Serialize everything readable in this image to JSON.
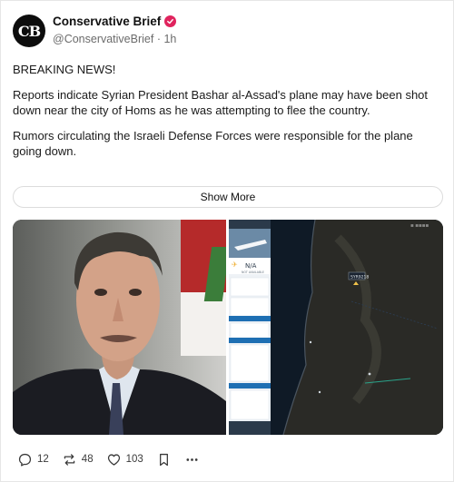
{
  "post": {
    "author": {
      "name": "Conservative Brief",
      "avatar_text": "CB",
      "handle": "@ConservativeBrief",
      "separator": "·",
      "time": "1h"
    },
    "paragraphs": [
      "BREAKING NEWS!",
      "Reports indicate Syrian President Bashar al-Assad's plane may have been shot down near the city of Homs as he was attempting to flee the country.",
      "Rumors circulating the Israeli Defense Forces were responsible for the plane going down."
    ],
    "show_more_label": "Show More",
    "flight_tracker": {
      "status_value": "N/A",
      "status_label": "NOT AVAILABLE",
      "callsign": "SYR9218"
    }
  },
  "actions": {
    "replies": "12",
    "reposts": "48",
    "likes": "103"
  },
  "colors": {
    "verified": "#e0245e",
    "map_background": "#101820",
    "tracker_accent": "#1e6fb3"
  }
}
